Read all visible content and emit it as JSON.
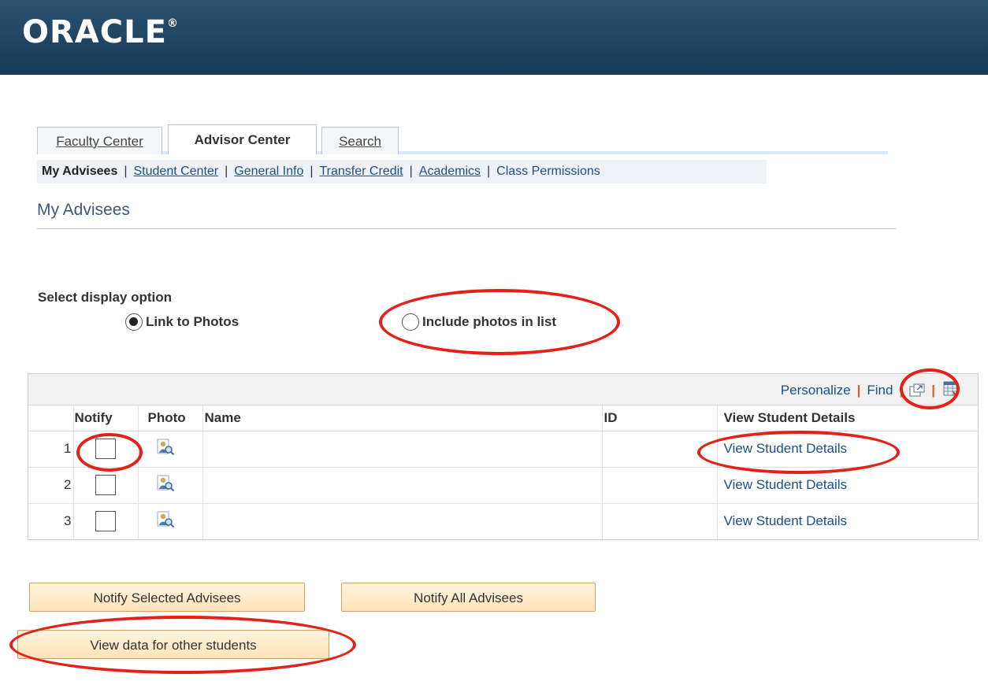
{
  "header": {
    "logo_text": "ORACLE",
    "logo_mark": "®"
  },
  "tabs": [
    {
      "label": "Faculty Center"
    },
    {
      "label": "Advisor Center"
    },
    {
      "label": "Search"
    }
  ],
  "subnav": {
    "current": "My Advisees",
    "links": [
      "Student Center",
      "General Info",
      "Transfer Credit",
      "Academics",
      "Class Permissions"
    ]
  },
  "page": {
    "title": "My Advisees"
  },
  "display_option": {
    "label": "Select display option",
    "options": [
      {
        "label": "Link to Photos",
        "selected": true
      },
      {
        "label": "Include photos in list",
        "selected": false
      }
    ]
  },
  "grid": {
    "toolbar": {
      "personalize": "Personalize",
      "find": "Find",
      "separator": "|"
    },
    "columns": {
      "notify": "Notify",
      "photo": "Photo",
      "name": "Name",
      "id": "ID",
      "view": "View Student Details"
    },
    "rows": [
      {
        "num": "1",
        "name": "",
        "id": "",
        "view": "View Student Details"
      },
      {
        "num": "2",
        "name": "",
        "id": "",
        "view": "View Student Details"
      },
      {
        "num": "3",
        "name": "",
        "id": "",
        "view": "View Student Details"
      }
    ]
  },
  "buttons": {
    "notify_selected": "Notify Selected Advisees",
    "notify_all": "Notify All Advisees",
    "view_other": "View data for other students"
  },
  "colors": {
    "banner": "#1f4563",
    "link": "#1b4f8a",
    "annotation": "#e32118",
    "button": "#fde4b8"
  }
}
